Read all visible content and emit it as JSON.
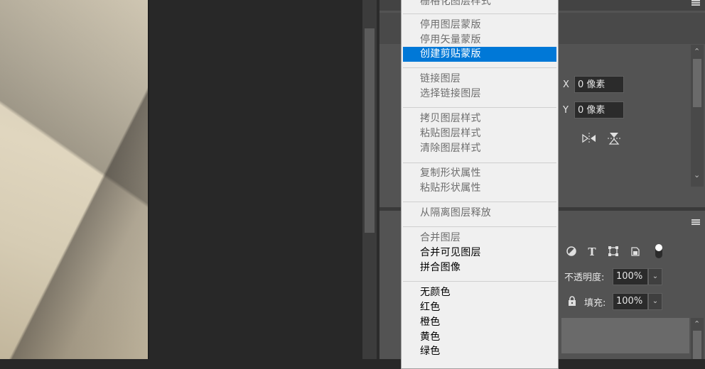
{
  "properties_panel": {
    "x_label": "X",
    "x_value": "0 像素",
    "y_label": "Y",
    "y_value": "0 像素",
    "flip_horizontal_icon": "flip-horizontal-icon",
    "flip_vertical_icon": "flip-vertical-icon"
  },
  "layers_panel": {
    "filter_icons": [
      "adjustment-circle-icon",
      "type-icon",
      "transform-box-icon",
      "smart-object-icon",
      "toggle-icon"
    ],
    "opacity_label": "不透明度:",
    "opacity_value": "100%",
    "lock_icon": "lock-icon",
    "fill_label": "填充:",
    "fill_value": "100%",
    "dropdown_glyph": "⌄"
  },
  "context_menu": {
    "items": [
      {
        "label": "栅格化图层样式",
        "enabled": false
      },
      {
        "label": "停用图层蒙版",
        "enabled": false
      },
      {
        "label": "停用矢量蒙版",
        "enabled": false
      },
      {
        "label": "创建剪贴蒙版",
        "enabled": true,
        "highlighted": true
      },
      {
        "label": "链接图层",
        "enabled": false
      },
      {
        "label": "选择链接图层",
        "enabled": false
      },
      {
        "label": "拷贝图层样式",
        "enabled": false
      },
      {
        "label": "粘贴图层样式",
        "enabled": false
      },
      {
        "label": "清除图层样式",
        "enabled": false
      },
      {
        "label": "复制形状属性",
        "enabled": false
      },
      {
        "label": "粘贴形状属性",
        "enabled": false
      },
      {
        "label": "从隔离图层释放",
        "enabled": false
      },
      {
        "label": "合并图层",
        "enabled": false
      },
      {
        "label": "合并可见图层",
        "enabled": true
      },
      {
        "label": "拼合图像",
        "enabled": true
      },
      {
        "label": "无颜色",
        "enabled": true
      },
      {
        "label": "红色",
        "enabled": true
      },
      {
        "label": "橙色",
        "enabled": true
      },
      {
        "label": "黄色",
        "enabled": true
      },
      {
        "label": "绿色",
        "enabled": true
      }
    ]
  },
  "colors": {
    "menu_highlight": "#0078d7",
    "panel_bg": "#535353",
    "canvas_bg": "#282828"
  }
}
